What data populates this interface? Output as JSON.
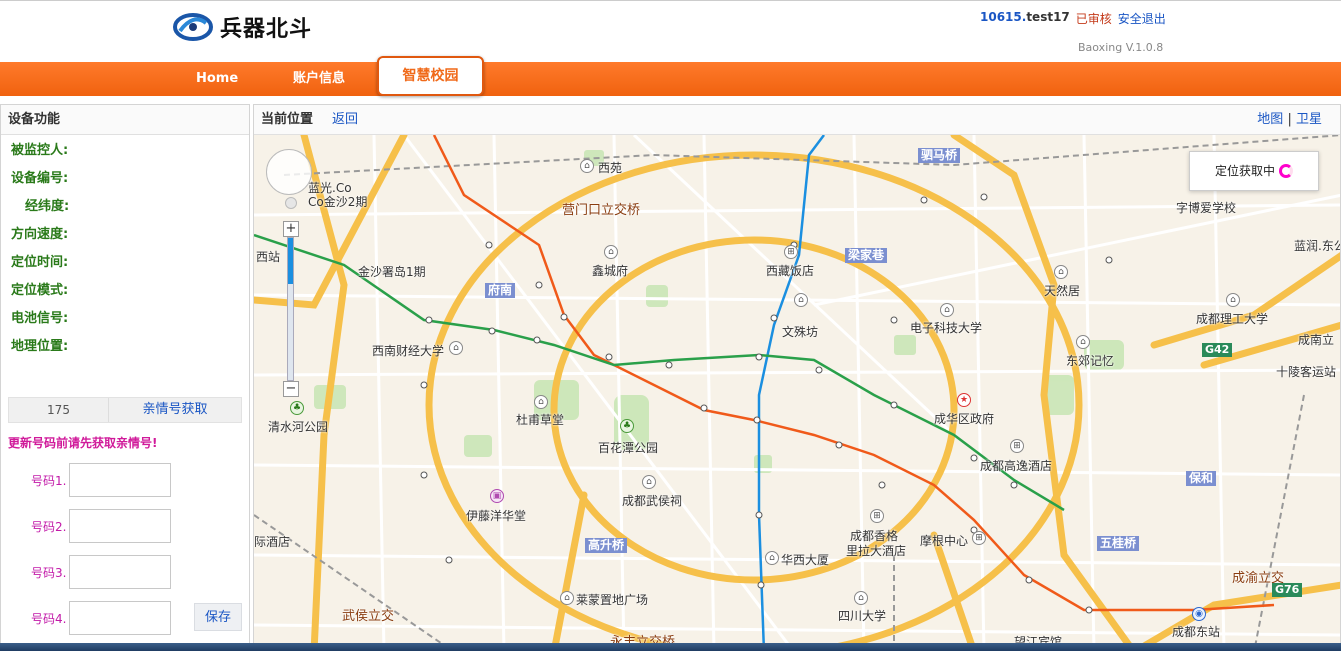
{
  "header": {
    "brand": "兵器北斗",
    "user_id": "10615.",
    "user_name": "test17",
    "status": "已审核",
    "logout": "安全退出",
    "version": "Baoxing  V.1.0.8"
  },
  "nav": {
    "home": "Home",
    "account": "账户信息",
    "campus": "智慧校园"
  },
  "left": {
    "title": "设备功能",
    "fields": [
      "被监控人:",
      "设备编号:",
      "经纬度:",
      "方向速度:",
      "定位时间:",
      "定位模式:",
      "电池信号:",
      "地理位置:"
    ],
    "count": "175",
    "fetch_btn": "亲情号获取",
    "warning": "更新号码前请先获取亲情号!",
    "numbers": [
      {
        "label": "号码1.",
        "value": ""
      },
      {
        "label": "号码2.",
        "value": ""
      },
      {
        "label": "号码3.",
        "value": ""
      },
      {
        "label": "号码4.",
        "value": ""
      }
    ],
    "save": "保存"
  },
  "right": {
    "title": "当前位置",
    "back": "返回",
    "map_type": "地图",
    "sat_type": "卫星",
    "separator": "|",
    "loading": "定位获取中"
  },
  "map_labels": {
    "xiyuan": "西苑",
    "yingmen": "营门口立交桥",
    "xincheng": "鑫城府",
    "xizang": "西藏饭店",
    "liangjia": "梁家巷",
    "fu_nan": "府南",
    "wenshu": "文殊坊",
    "dianzi": "电子科技大学",
    "xinan": "西南财经大学",
    "jinsha": "金沙署岛1期",
    "lanco": "蓝光.Co",
    "lanco2": "Co金沙2期",
    "xizhan": "西站",
    "qingshuihe": "清水河公园",
    "dufu": "杜甫草堂",
    "baihua": "百花潭公园",
    "wuhou": "成都武侯祠",
    "yitang": "伊藤洋华堂",
    "gaosheng": "高升桥",
    "huaxi": "华西大厦",
    "xiangge": "成都香格",
    "xiangge2": "里拉大酒店",
    "mogen": "摩根中心",
    "wuguiqiao": "五桂桥",
    "chenghua": "成华区政府",
    "gaoyi": "成都高逸酒店",
    "baohe": "保和",
    "chengyu": "成渝立交",
    "dongzhan": "成都东站",
    "wuhouli": "武侯立交",
    "laifu": "莱蒙置地广场",
    "sichuan": "四川大学",
    "yongfeng": "永丰立交桥",
    "wanjiang": "望江宾馆",
    "jiulong": "驷马桥",
    "tianran": "天然居",
    "ligong": "成都理工大学",
    "dongjiao": "东郊记忆",
    "chengnan": "成南立",
    "shilingdang": "十陵客运站",
    "lanrun": "蓝润.东公",
    "zihui": "字博爱学校",
    "g42": "G42",
    "g76": "G76",
    "xijiudian": "际酒店"
  },
  "colors": {
    "nav_orange": "#f06a1a",
    "link_blue": "#1a56c4",
    "field_green": "#2a7a1a",
    "warn_magenta": "#d01a9a",
    "metro_orange": "#f05a1a",
    "metro_blue": "#1b8fe0",
    "metro_green": "#2aa04a",
    "road_yellow": "#f6c04a"
  }
}
